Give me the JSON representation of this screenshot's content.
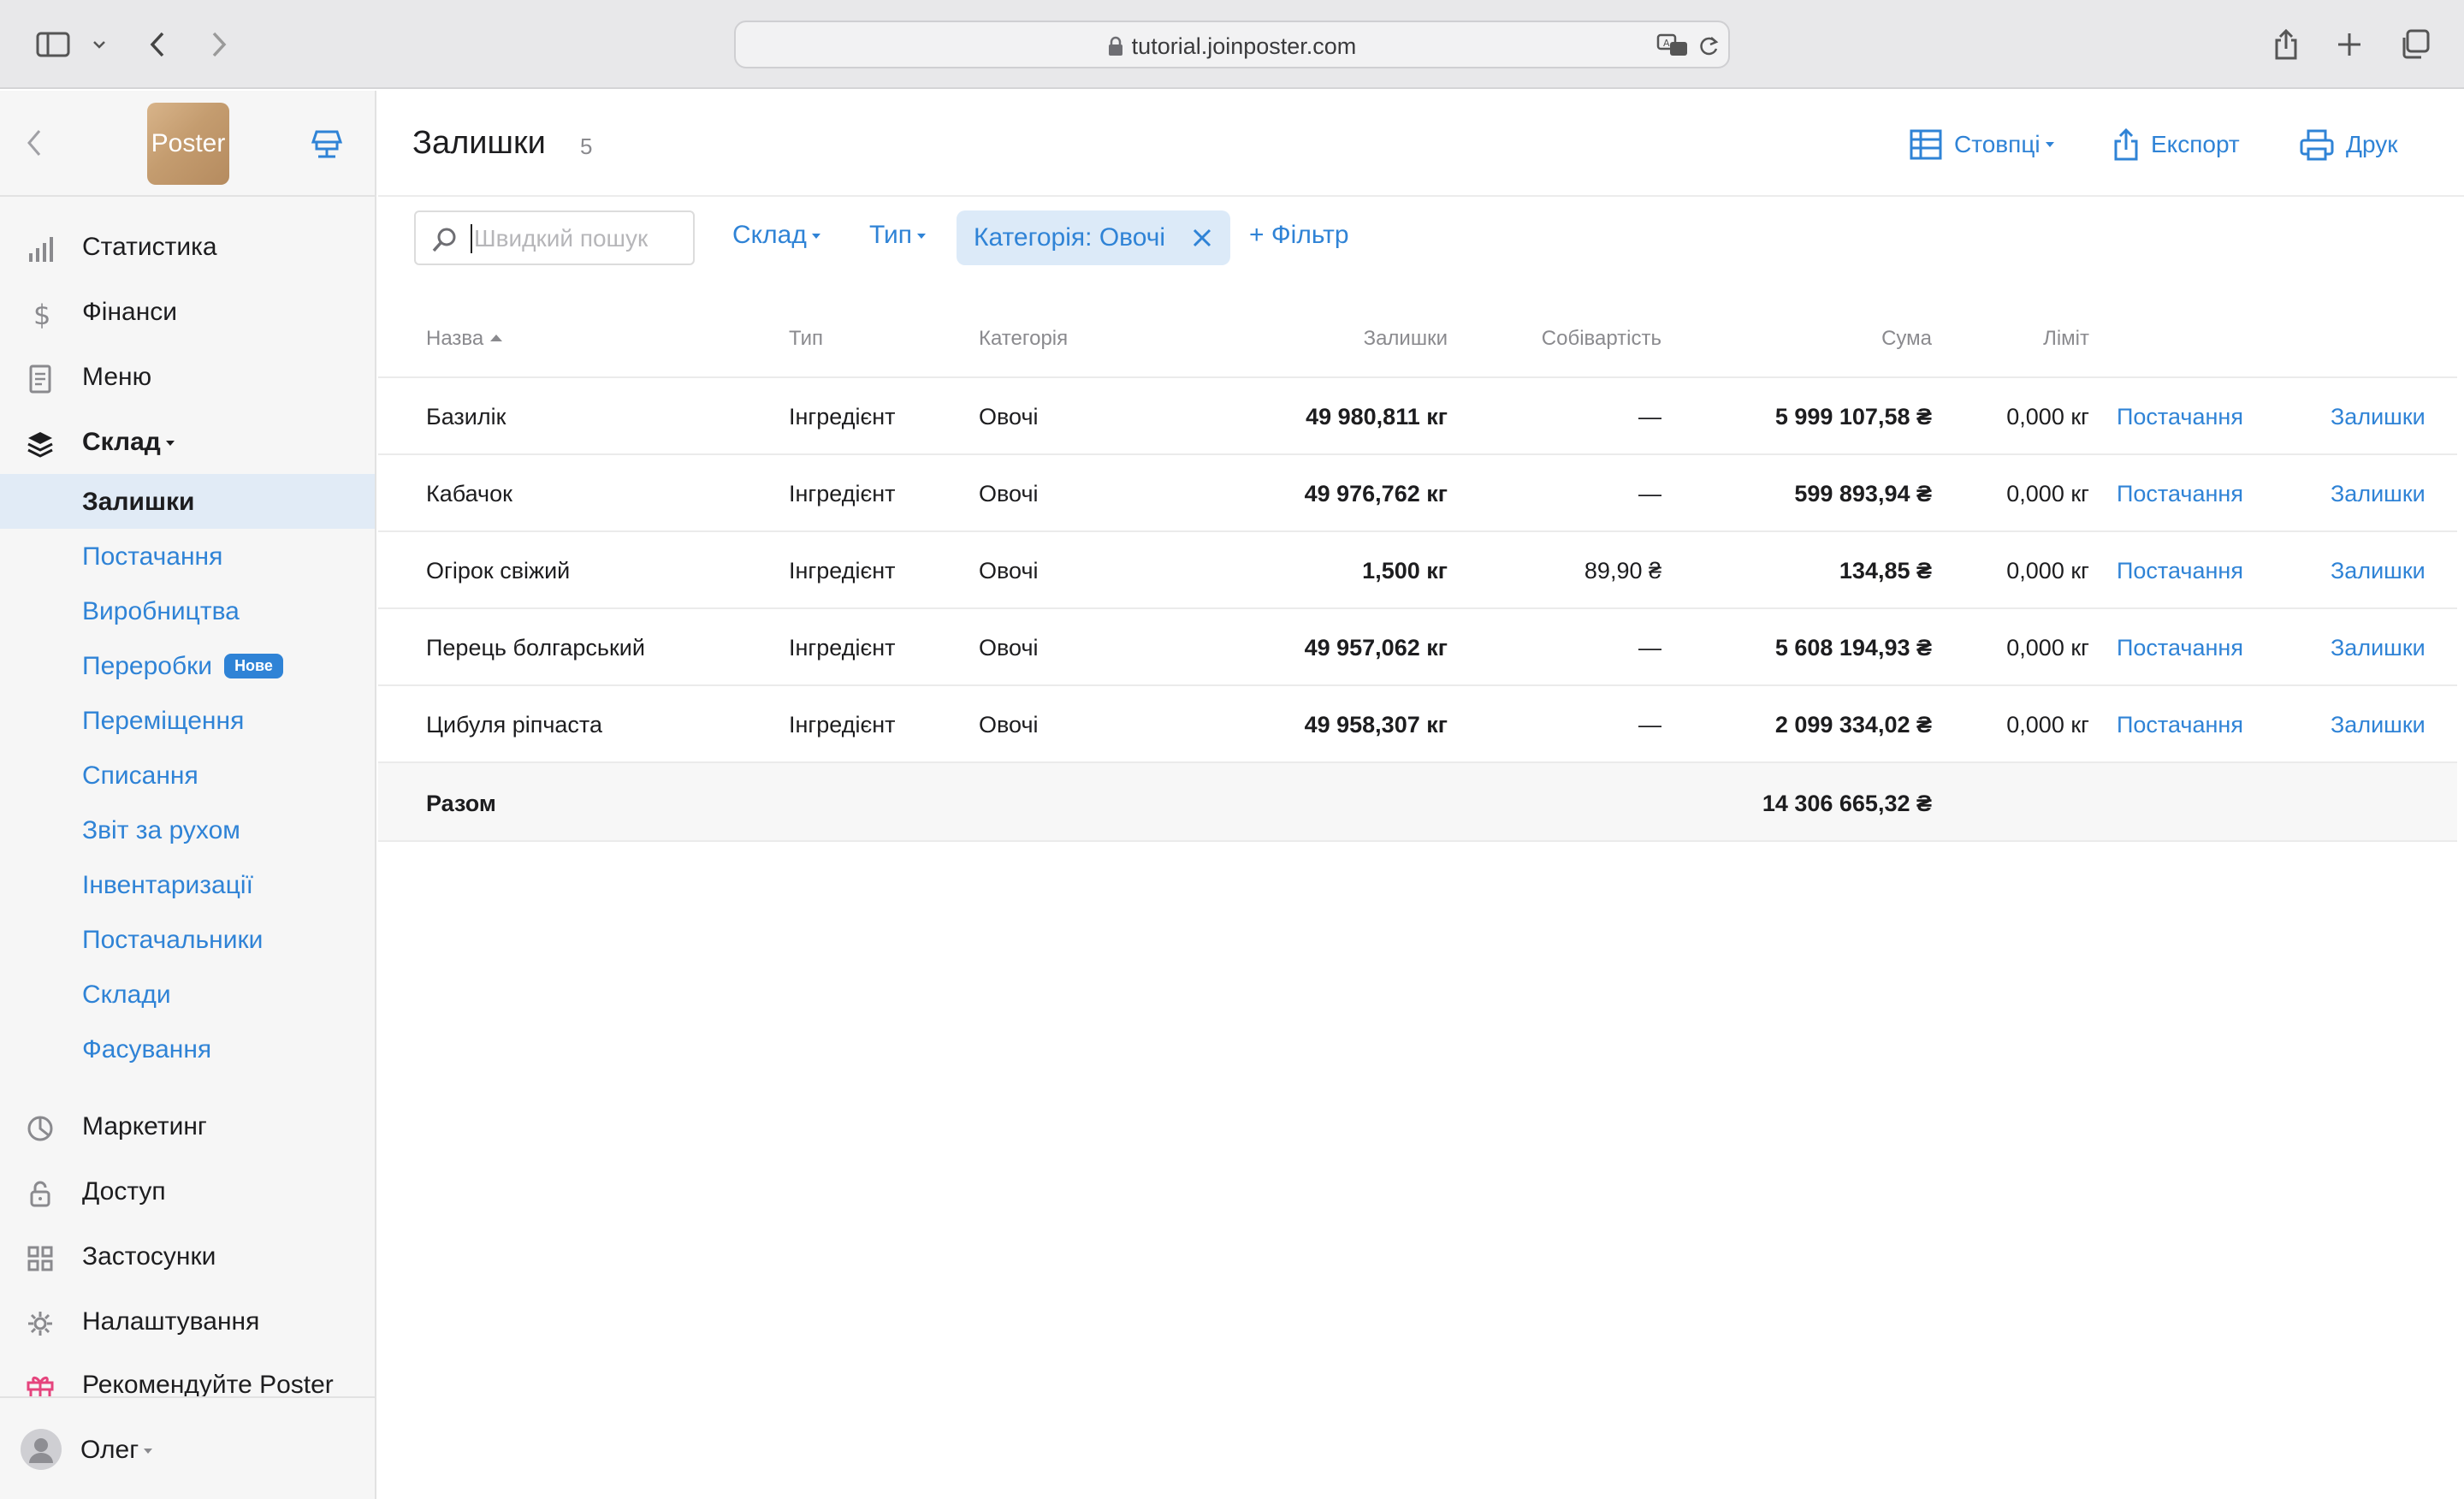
{
  "browser": {
    "url": "tutorial.joinposter.com"
  },
  "sidebar": {
    "logo_text": "Poster",
    "main_items": [
      {
        "label": "Статистика",
        "icon": "bar-chart-icon"
      },
      {
        "label": "Фінанси",
        "icon": "dollar-icon"
      },
      {
        "label": "Меню",
        "icon": "document-icon"
      },
      {
        "label": "Склад",
        "icon": "layers-icon"
      }
    ],
    "sub_items": [
      {
        "label": "Залишки",
        "active": true
      },
      {
        "label": "Постачання"
      },
      {
        "label": "Виробництва"
      },
      {
        "label": "Переробки",
        "badge": "Нове"
      },
      {
        "label": "Переміщення"
      },
      {
        "label": "Списання"
      },
      {
        "label": "Звіт за рухом"
      },
      {
        "label": "Інвентаризації"
      },
      {
        "label": "Постачальники"
      },
      {
        "label": "Склади"
      },
      {
        "label": "Фасування"
      }
    ],
    "bottom_items": [
      {
        "label": "Маркетинг",
        "icon": "pie-chart-icon"
      },
      {
        "label": "Доступ",
        "icon": "lock-icon"
      },
      {
        "label": "Застосунки",
        "icon": "grid-icon"
      },
      {
        "label": "Налаштування",
        "icon": "gear-icon"
      },
      {
        "label": "Рекомендуйте Poster",
        "icon": "gift-icon"
      }
    ],
    "user": "Олег"
  },
  "page": {
    "title": "Залишки",
    "count": "5",
    "columns_button": "Стовпці",
    "export_button": "Експорт",
    "print_button": "Друк"
  },
  "filters": {
    "search_placeholder": "Швидкий пошук",
    "warehouse": "Склад",
    "type": "Тип",
    "category_chip": "Категорія: Овочі",
    "add_filter": "+ Фільтр"
  },
  "table": {
    "headers": {
      "name": "Назва",
      "type": "Тип",
      "category": "Категорія",
      "stock": "Залишки",
      "cost": "Собівартість",
      "sum": "Сума",
      "limit": "Ліміт"
    },
    "rows": [
      {
        "name": "Базилік",
        "type": "Інгредієнт",
        "category": "Овочі",
        "stock": "49 980,811 кг",
        "cost": "—",
        "sum": "5 999 107,58 ₴",
        "limit": "0,000 кг",
        "link1": "Постачання",
        "link2": "Залишки"
      },
      {
        "name": "Кабачок",
        "type": "Інгредієнт",
        "category": "Овочі",
        "stock": "49 976,762 кг",
        "cost": "—",
        "sum": "599 893,94 ₴",
        "limit": "0,000 кг",
        "link1": "Постачання",
        "link2": "Залишки"
      },
      {
        "name": "Огірок свіжий",
        "type": "Інгредієнт",
        "category": "Овочі",
        "stock": "1,500 кг",
        "cost": "89,90 ₴",
        "sum": "134,85 ₴",
        "limit": "0,000 кг",
        "link1": "Постачання",
        "link2": "Залишки"
      },
      {
        "name": "Перець болгарський",
        "type": "Інгредієнт",
        "category": "Овочі",
        "stock": "49 957,062 кг",
        "cost": "—",
        "sum": "5 608 194,93 ₴",
        "limit": "0,000 кг",
        "link1": "Постачання",
        "link2": "Залишки"
      },
      {
        "name": "Цибуля ріпчаста",
        "type": "Інгредієнт",
        "category": "Овочі",
        "stock": "49 958,307 кг",
        "cost": "—",
        "sum": "2 099 334,02 ₴",
        "limit": "0,000 кг",
        "link1": "Постачання",
        "link2": "Залишки"
      }
    ],
    "total_label": "Разом",
    "total_sum": "14 306 665,32 ₴"
  },
  "colors": {
    "accent": "#2f83d6",
    "active_bg": "#e1ebf6"
  }
}
